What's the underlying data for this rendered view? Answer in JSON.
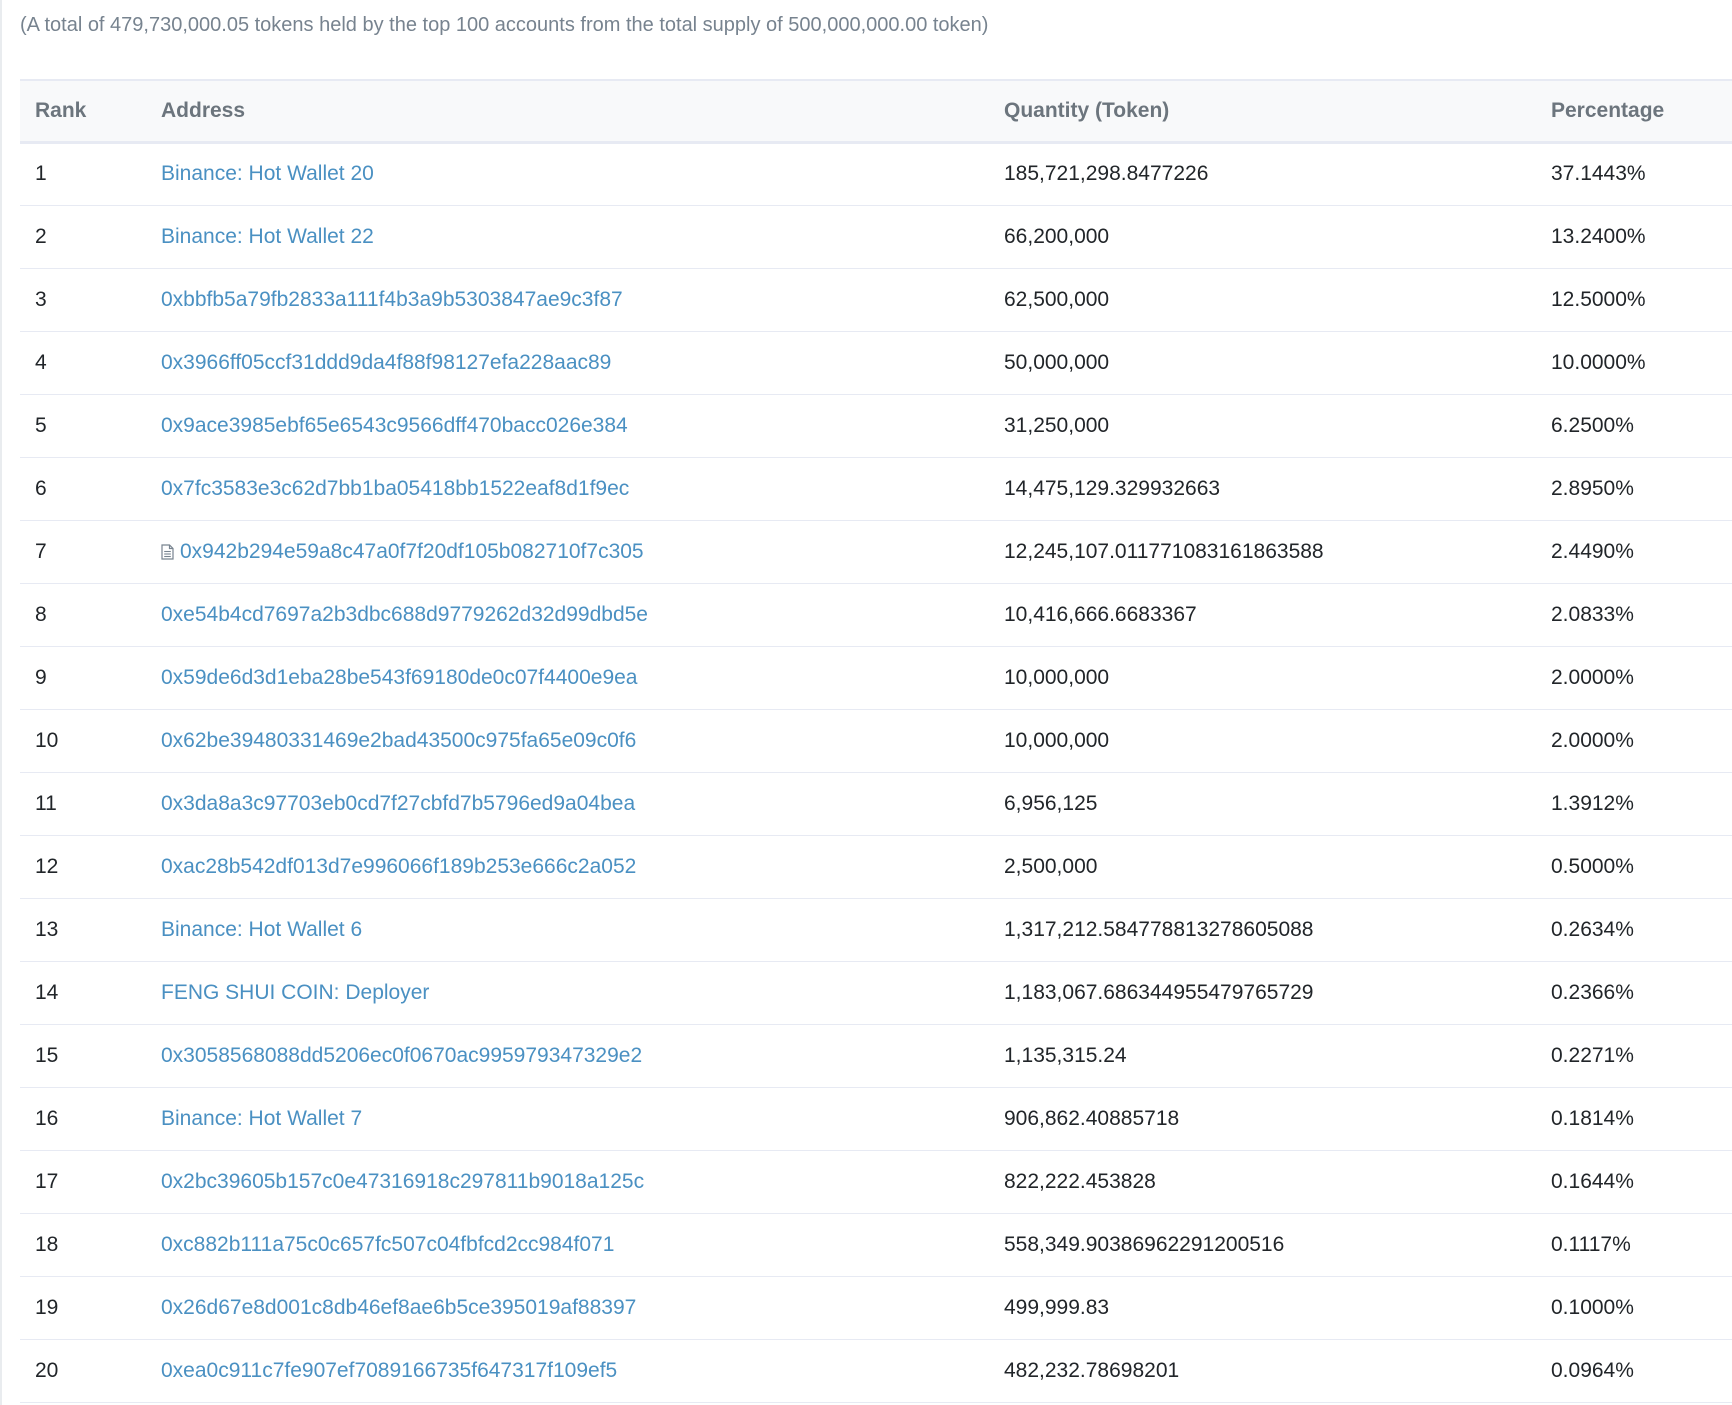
{
  "summary": "(A total of 479,730,000.05 tokens held by the top 100 accounts from the total supply of 500,000,000.00 token)",
  "columns": {
    "rank": "Rank",
    "address": "Address",
    "quantity": "Quantity (Token)",
    "percentage": "Percentage"
  },
  "rows": [
    {
      "rank": "1",
      "address": "Binance: Hot Wallet 20",
      "quantity": "185,721,298.8477226",
      "percentage": "37.1443%",
      "contract": false
    },
    {
      "rank": "2",
      "address": "Binance: Hot Wallet 22",
      "quantity": "66,200,000",
      "percentage": "13.2400%",
      "contract": false
    },
    {
      "rank": "3",
      "address": "0xbbfb5a79fb2833a111f4b3a9b5303847ae9c3f87",
      "quantity": "62,500,000",
      "percentage": "12.5000%",
      "contract": false
    },
    {
      "rank": "4",
      "address": "0x3966ff05ccf31ddd9da4f88f98127efa228aac89",
      "quantity": "50,000,000",
      "percentage": "10.0000%",
      "contract": false
    },
    {
      "rank": "5",
      "address": "0x9ace3985ebf65e6543c9566dff470bacc026e384",
      "quantity": "31,250,000",
      "percentage": "6.2500%",
      "contract": false
    },
    {
      "rank": "6",
      "address": "0x7fc3583e3c62d7bb1ba05418bb1522eaf8d1f9ec",
      "quantity": "14,475,129.329932663",
      "percentage": "2.8950%",
      "contract": false
    },
    {
      "rank": "7",
      "address": "0x942b294e59a8c47a0f7f20df105b082710f7c305",
      "quantity": "12,245,107.011771083161863588",
      "percentage": "2.4490%",
      "contract": true
    },
    {
      "rank": "8",
      "address": "0xe54b4cd7697a2b3dbc688d9779262d32d99dbd5e",
      "quantity": "10,416,666.6683367",
      "percentage": "2.0833%",
      "contract": false
    },
    {
      "rank": "9",
      "address": "0x59de6d3d1eba28be543f69180de0c07f4400e9ea",
      "quantity": "10,000,000",
      "percentage": "2.0000%",
      "contract": false
    },
    {
      "rank": "10",
      "address": "0x62be39480331469e2bad43500c975fa65e09c0f6",
      "quantity": "10,000,000",
      "percentage": "2.0000%",
      "contract": false
    },
    {
      "rank": "11",
      "address": "0x3da8a3c97703eb0cd7f27cbfd7b5796ed9a04bea",
      "quantity": "6,956,125",
      "percentage": "1.3912%",
      "contract": false
    },
    {
      "rank": "12",
      "address": "0xac28b542df013d7e996066f189b253e666c2a052",
      "quantity": "2,500,000",
      "percentage": "0.5000%",
      "contract": false
    },
    {
      "rank": "13",
      "address": "Binance: Hot Wallet 6",
      "quantity": "1,317,212.584778813278605088",
      "percentage": "0.2634%",
      "contract": false
    },
    {
      "rank": "14",
      "address": "FENG SHUI COIN: Deployer",
      "quantity": "1,183,067.686344955479765729",
      "percentage": "0.2366%",
      "contract": false
    },
    {
      "rank": "15",
      "address": "0x3058568088dd5206ec0f0670ac995979347329e2",
      "quantity": "1,135,315.24",
      "percentage": "0.2271%",
      "contract": false
    },
    {
      "rank": "16",
      "address": "Binance: Hot Wallet 7",
      "quantity": "906,862.40885718",
      "percentage": "0.1814%",
      "contract": false
    },
    {
      "rank": "17",
      "address": "0x2bc39605b157c0e47316918c297811b9018a125c",
      "quantity": "822,222.453828",
      "percentage": "0.1644%",
      "contract": false
    },
    {
      "rank": "18",
      "address": "0xc882b111a75c0c657fc507c04fbfcd2cc984f071",
      "quantity": "558,349.90386962291200516",
      "percentage": "0.1117%",
      "contract": false
    },
    {
      "rank": "19",
      "address": "0x26d67e8d001c8db46ef8ae6b5ce395019af88397",
      "quantity": "499,999.83",
      "percentage": "0.1000%",
      "contract": false
    },
    {
      "rank": "20",
      "address": "0xea0c911c7fe907ef7089166735f647317f109ef5",
      "quantity": "482,232.78698201",
      "percentage": "0.0964%",
      "contract": false
    }
  ]
}
